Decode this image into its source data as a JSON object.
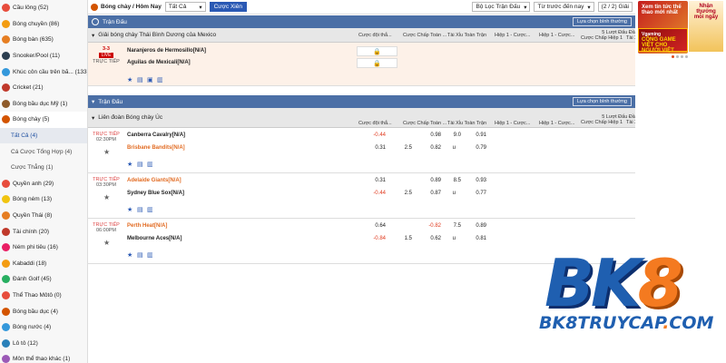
{
  "sidebar": {
    "items": [
      {
        "label": "Cầu lông (52)",
        "color": "#e74c3c"
      },
      {
        "label": "Bóng chuyền (86)",
        "color": "#f39c12"
      },
      {
        "label": "Bóng bàn (635)",
        "color": "#e67e22"
      },
      {
        "label": "Snooker/Pool (11)",
        "color": "#2c3e50"
      },
      {
        "label": "Khúc côn cầu trên bă... (133)",
        "color": "#3498db"
      },
      {
        "label": "Cricket (21)",
        "color": "#c0392b"
      },
      {
        "label": "Bóng bầu dục Mỹ (1)",
        "color": "#8e5a2a"
      },
      {
        "label": "Bóng chày (5)",
        "color": "#d35400"
      }
    ],
    "subitems": [
      {
        "label": "Tất Cả (4)"
      },
      {
        "label": "Cá Cược Tổng Hợp (4)"
      },
      {
        "label": "Cược Thẳng (1)"
      }
    ],
    "items2": [
      {
        "label": "Quyền anh (29)",
        "color": "#e74c3c"
      },
      {
        "label": "Bóng ném (13)",
        "color": "#f1c40f"
      },
      {
        "label": "Quyền Thái (8)",
        "color": "#e67e22"
      },
      {
        "label": "Tài chính (20)",
        "color": "#c0392b"
      },
      {
        "label": "Ném phi tiêu (16)",
        "color": "#e91e63"
      },
      {
        "label": "Kabaddi (18)",
        "color": "#f39c12"
      },
      {
        "label": "Đánh Golf (45)",
        "color": "#27ae60"
      },
      {
        "label": "Thể Thao Môtô (0)",
        "color": "#e74c3c"
      },
      {
        "label": "Bóng bầu dục (4)",
        "color": "#d35400"
      },
      {
        "label": "Bóng nước (4)",
        "color": "#3498db"
      },
      {
        "label": "Lô tô (12)",
        "color": "#2980b9"
      },
      {
        "label": "Môn thể thao khác (1)",
        "color": "#9b59b6"
      }
    ]
  },
  "topbar": {
    "title": "Bóng chày / Hôm Nay",
    "filter": "Tất Cả",
    "button": "Cược Xiên",
    "league_filter": "Bộ Lọc Trận Đấu",
    "sort": "Từ trước đến nay",
    "page": "(2 / 2) Giải"
  },
  "section1": {
    "header": "Trận Đấu",
    "option": "Lựa chọn bình thường",
    "league": "Giải bóng chày Thái Bình Dương của Mexico",
    "cols": {
      "c1": "Cược đội thắ...",
      "c2": "Cược Chấp Toàn ...",
      "c3": "Tài Xỉu Toàn Trận",
      "c4": "Hiệp 1 - Cược...",
      "c5": "Hiệp 1 - Cược...",
      "c6top": "5 Lượt Đấu Đầu Tiên",
      "c6": "Cược Chấp Hiệp 1",
      "c7": "Tài Xỉu Hiệp 1"
    },
    "match": {
      "score": "3-3",
      "live": "LIVE",
      "status": "TRỰC TIẾP",
      "home": "Naranjeros de Hermosillo[N/A]",
      "away": "Aguilas de Mexicali[N/A]"
    }
  },
  "section2": {
    "header": "Trận Đấu",
    "option": "Lựa chọn bình thường",
    "league": "Liên đoàn Bóng chày Úc",
    "cols": {
      "c1": "Cược đội thắ...",
      "c2": "Cược Chấp Toàn ...",
      "c3": "Tài Xỉu Toàn Trận",
      "c4": "Hiệp 1 - Cược...",
      "c5": "Hiệp 1 - Cược...",
      "c6top": "5 Lượt Đấu Đầu Tiên",
      "c6": "Cược Chấp Hiệp 1",
      "c7": "Tài Xỉu Hiệp 1"
    },
    "matches": [
      {
        "status": "TRỰC TIẾP",
        "time": "02:30PM",
        "home": "Canberra Cavalry[N/A]",
        "away": "Brisbane Bandits[N/A]",
        "h_ml": "-0.44",
        "a_ml": "0.31",
        "a_hdp": "2.5",
        "h_hdp_odd": "0.98",
        "a_hdp_odd": "0.82",
        "h_ou": "9.0",
        "a_ou": "u",
        "h_ou_odd": "0.91",
        "a_ou_odd": "0.79",
        "orange": "away"
      },
      {
        "status": "TRỰC TIẾP",
        "time": "03:30PM",
        "home": "Adelaide Giants[N/A]",
        "away": "Sydney Blue Sox[N/A]",
        "h_ml": "0.31",
        "a_ml": "-0.44",
        "a_hdp": "2.5",
        "h_hdp_odd": "0.89",
        "a_hdp_odd": "0.87",
        "h_ou": "8.5",
        "a_ou": "u",
        "h_ou_odd": "0.93",
        "a_ou_odd": "0.77",
        "orange": "home"
      },
      {
        "status": "TRỰC TIẾP",
        "time": "06:00PM",
        "home": "Perth Heat[N/A]",
        "away": "Melbourne Aces[N/A]",
        "h_ml": "0.64",
        "a_ml": "-0.84",
        "a_hdp": "1.5",
        "h_hdp_odd": "-0.82",
        "a_hdp_odd": "0.62",
        "h_ou": "7.5",
        "a_ou": "u",
        "h_ou_odd": "0.89",
        "a_ou_odd": "0.81",
        "orange": "home"
      }
    ]
  },
  "ads": {
    "ad1": "Xem tin tức thể thao mới nhất",
    "ad2": "CỔNG GAME VIỆT CHO NGƯỜI VIỆT",
    "ad2_brand": "Vgaming",
    "ad3": "Nhận thưởng mỗi ngày"
  },
  "logo": {
    "part1": "BK",
    "part2": "8",
    "url_a": "BK8TRUYCAP",
    "url_b": ".",
    "url_c": "COM"
  }
}
